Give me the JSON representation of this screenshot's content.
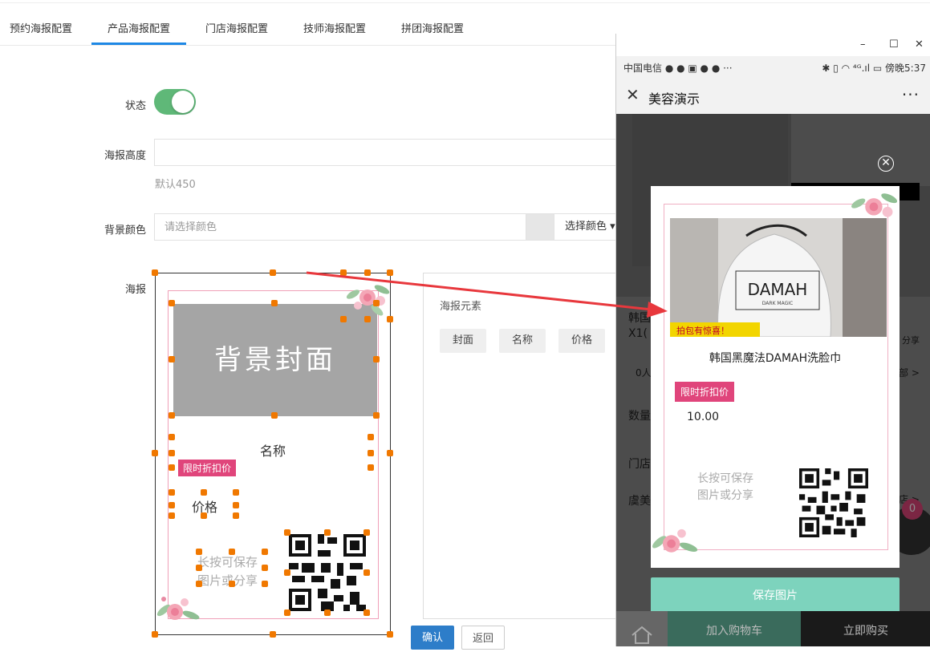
{
  "tabs": [
    {
      "label": "预约海报配置"
    },
    {
      "label": "产品海报配置"
    },
    {
      "label": "门店海报配置"
    },
    {
      "label": "技师海报配置"
    },
    {
      "label": "拼团海报配置"
    }
  ],
  "active_tab": "产品海报配置",
  "form": {
    "status_label": "状态",
    "status_on": true,
    "height_label": "海报高度",
    "height_value": "",
    "height_hint": "默认450",
    "bg_color_label": "背景颜色",
    "bg_color_placeholder": "请选择颜色",
    "bg_color_button": "选择颜色 ▾",
    "poster_label": "海报"
  },
  "poster_preview": {
    "cover_text": "背景封面",
    "name_text": "名称",
    "badge_text": "限时折扣价",
    "price_text": "价格",
    "save_tip_line1": "长按可保存",
    "save_tip_line2": "图片或分享"
  },
  "elements_panel": {
    "title": "海报元素",
    "buttons": [
      "封面",
      "名称",
      "价格"
    ]
  },
  "actions": {
    "confirm": "确认",
    "back": "返回"
  },
  "phone": {
    "window_controls": [
      "–",
      "☐",
      "✕"
    ],
    "carrier": "中国电信 ● ● ▣ ● ● ···",
    "status_right": "✱ ▯ ◠ ⁴ᴳ.ıl ▭ 傍晚5:37",
    "nav_close": "✕",
    "nav_title": "美容演示",
    "nav_more": "···",
    "bg_texts": [
      "韩国",
      "X1(",
      "0人",
      "数量",
      "门店",
      "虞美",
      "分享",
      "部 >",
      "店 >"
    ],
    "cart_badge": "0",
    "card": {
      "product_name": "韩国黑魔法DAMAH洗脸巾",
      "badge": "限时折扣价",
      "price": "10.00",
      "save_tip_line1": "长按可保存",
      "save_tip_line2": "图片或分享",
      "image_brand": "DAMAH",
      "image_sub": "DARK MAGIC",
      "image_banner": "拍包有惊喜！"
    },
    "save_button": "保存图片",
    "add_to_cart": "加入购物车",
    "buy_now": "立即购买"
  },
  "colors": {
    "accent": "#1e88e5",
    "toggle_on": "#5fb878",
    "badge": "#e0457b",
    "handle": "#f07800",
    "confirm": "#2d7dc9",
    "save_button": "#7dd3bd",
    "arrow": "#e8383d"
  }
}
